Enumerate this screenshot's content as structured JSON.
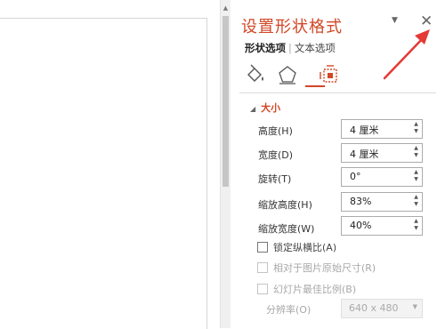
{
  "pane": {
    "title": "设置形状格式",
    "dropdown_glyph": "▼",
    "close_glyph": "✕",
    "tabs": [
      {
        "label": "形状选项",
        "active": true
      },
      {
        "label": "文本选项",
        "active": false
      }
    ],
    "tab_separator": "|",
    "icons": [
      "fill-line-icon",
      "effects-pentagon-icon",
      "size-properties-icon"
    ],
    "accent_color": "#d24726"
  },
  "size_section": {
    "triangle": "◢",
    "title": "大小",
    "fields": [
      {
        "label": "高度(H)",
        "value": "4 厘米"
      },
      {
        "label": "宽度(D)",
        "value": "4 厘米"
      },
      {
        "label": "旋转(T)",
        "value": "0°"
      },
      {
        "label": "缩放高度(H)",
        "value": "83%"
      },
      {
        "label": "缩放宽度(W)",
        "value": "40%"
      }
    ],
    "spin_up": "▲",
    "spin_down": "▼",
    "checkboxes": [
      {
        "label": "锁定纵横比(A)",
        "enabled": true,
        "checked": false
      },
      {
        "label": "相对于图片原始尺寸(R)",
        "enabled": false,
        "checked": false
      },
      {
        "label": "幻灯片最佳比例(B)",
        "enabled": false,
        "checked": false
      }
    ],
    "resolution": {
      "label": "分辨率(O)",
      "value": "640 x 480",
      "dd": "▼"
    }
  },
  "scrollbar": {
    "up_glyph": "▲"
  }
}
